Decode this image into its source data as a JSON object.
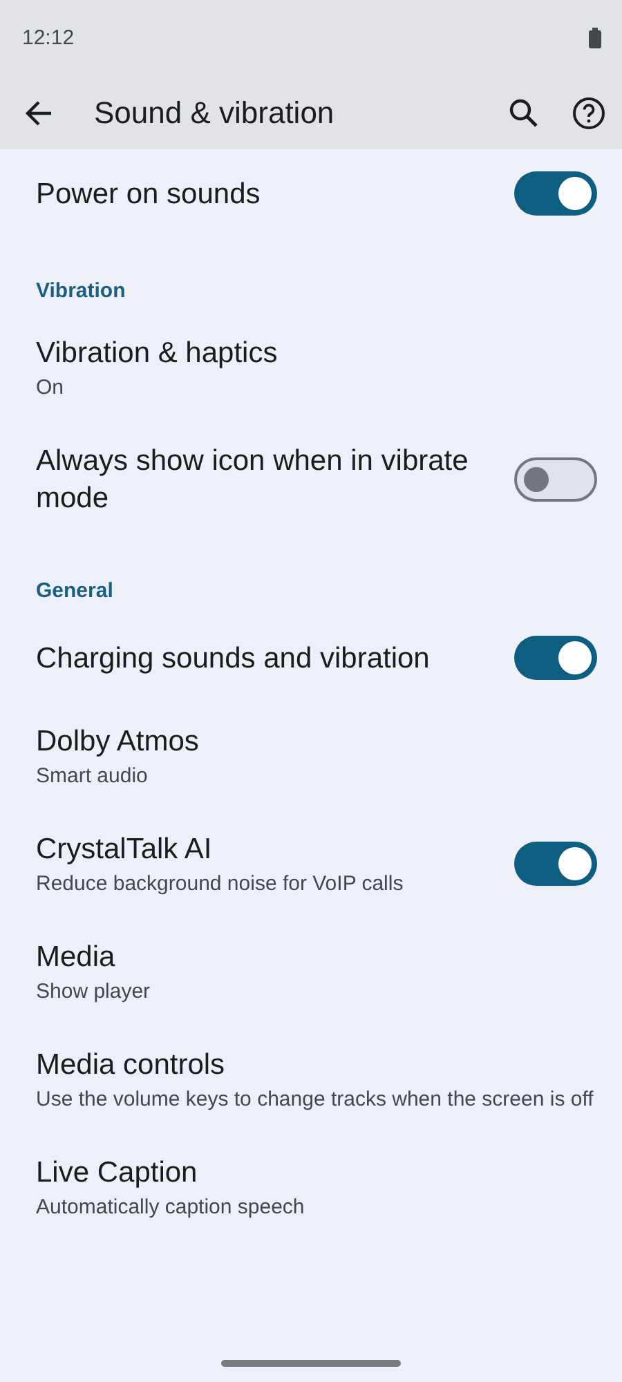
{
  "status_bar": {
    "time": "12:12"
  },
  "app_bar": {
    "title": "Sound & vibration"
  },
  "sections": [
    {
      "items": [
        {
          "kind": "toggle",
          "title": "Power on sounds",
          "on": true
        }
      ]
    },
    {
      "header": "Vibration",
      "items": [
        {
          "kind": "text",
          "title": "Vibration & haptics",
          "subtitle": "On"
        },
        {
          "kind": "toggle",
          "title": "Always show icon when in vibrate mode",
          "on": false
        }
      ]
    },
    {
      "header": "General",
      "items": [
        {
          "kind": "toggle",
          "title": "Charging sounds and vibration",
          "on": true
        },
        {
          "kind": "text",
          "title": "Dolby Atmos",
          "subtitle": "Smart audio"
        },
        {
          "kind": "toggle",
          "title": "CrystalTalk AI",
          "subtitle": "Reduce background noise for VoIP calls",
          "on": true
        },
        {
          "kind": "text",
          "title": "Media",
          "subtitle": "Show player"
        },
        {
          "kind": "text",
          "title": "Media controls",
          "subtitle": "Use the volume keys to change tracks when the screen is off"
        },
        {
          "kind": "text",
          "title": "Live Caption",
          "subtitle": "Automatically caption speech"
        }
      ]
    }
  ]
}
